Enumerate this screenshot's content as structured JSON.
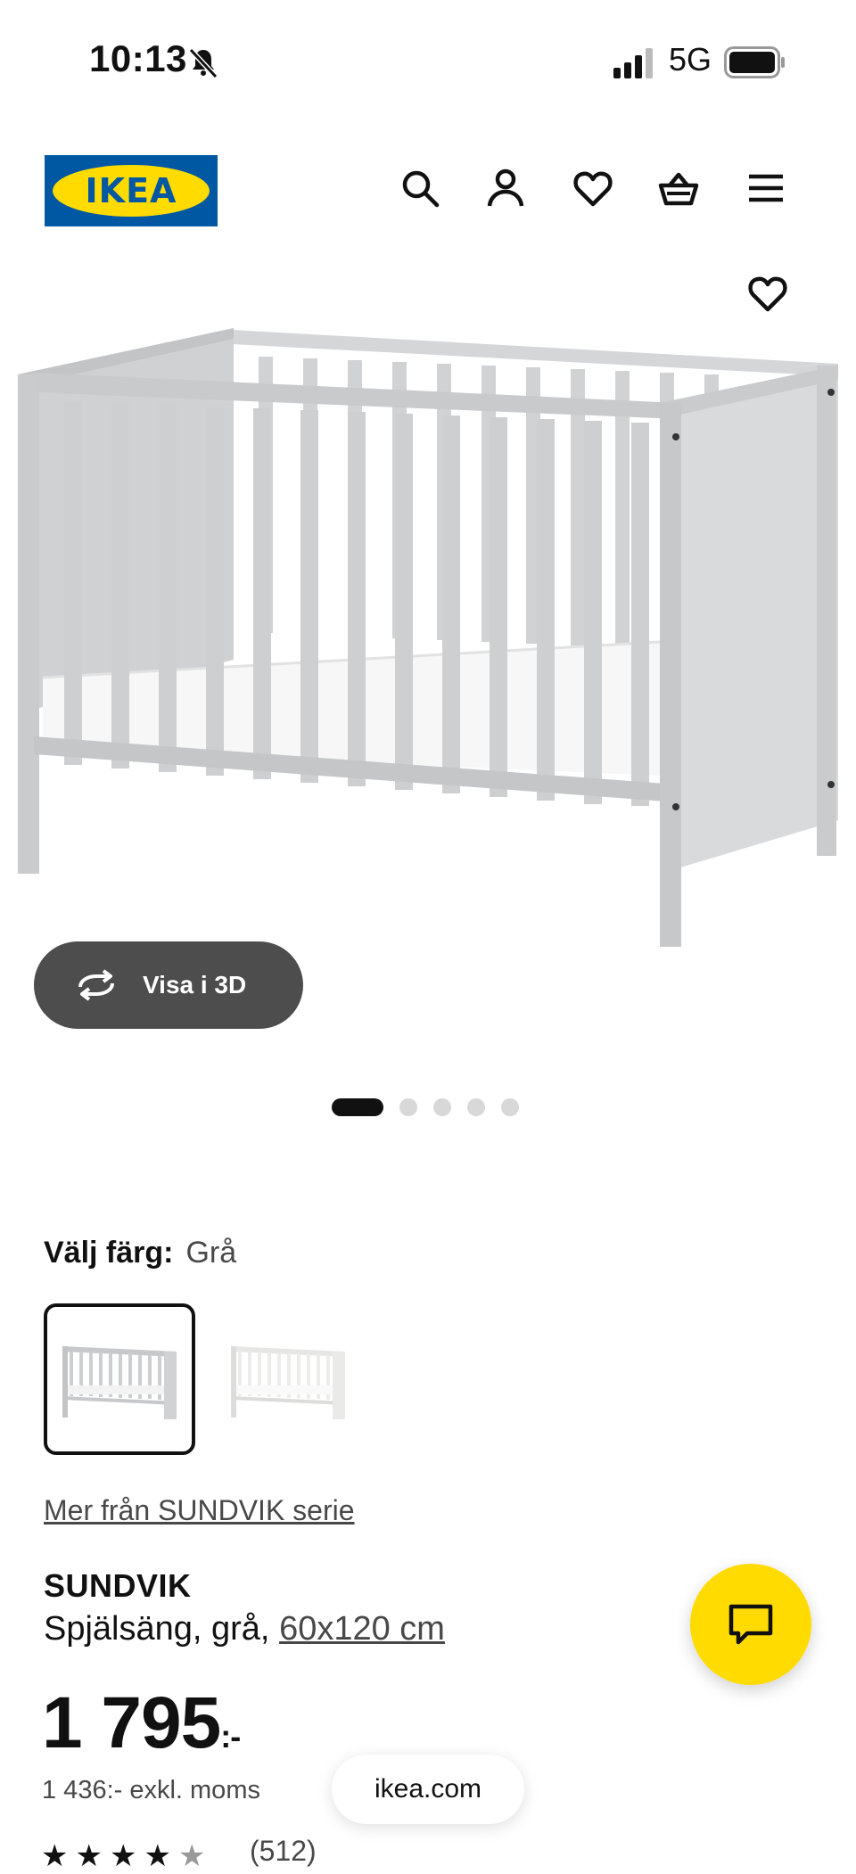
{
  "status": {
    "time": "10:13",
    "network": "5G"
  },
  "header": {
    "logo_text": "IKEA",
    "icons": [
      "search-icon",
      "user-icon",
      "heart-icon",
      "basket-icon",
      "menu-icon"
    ]
  },
  "gallery": {
    "view_3d_label": "Visa i 3D",
    "dot_count": 5,
    "active_index": 0
  },
  "color": {
    "label": "Välj färg:",
    "value": "Grå",
    "options": [
      "Grå",
      "Vit"
    ]
  },
  "product": {
    "series_link": "Mer från SUNDVIK serie",
    "name": "SUNDVIK",
    "description": "Spjälsäng, grå, ",
    "size_link": "60x120 cm",
    "price": "1 795",
    "price_suffix": ":-",
    "price_excl": "1 436:- exkl. moms",
    "rating": 4.5,
    "review_count": "(512)"
  },
  "browser": {
    "url": "ikea.com"
  },
  "colors": {
    "ikea_blue": "#0058a3",
    "ikea_yellow": "#ffdb00",
    "button_dark": "#4d4d4d"
  }
}
